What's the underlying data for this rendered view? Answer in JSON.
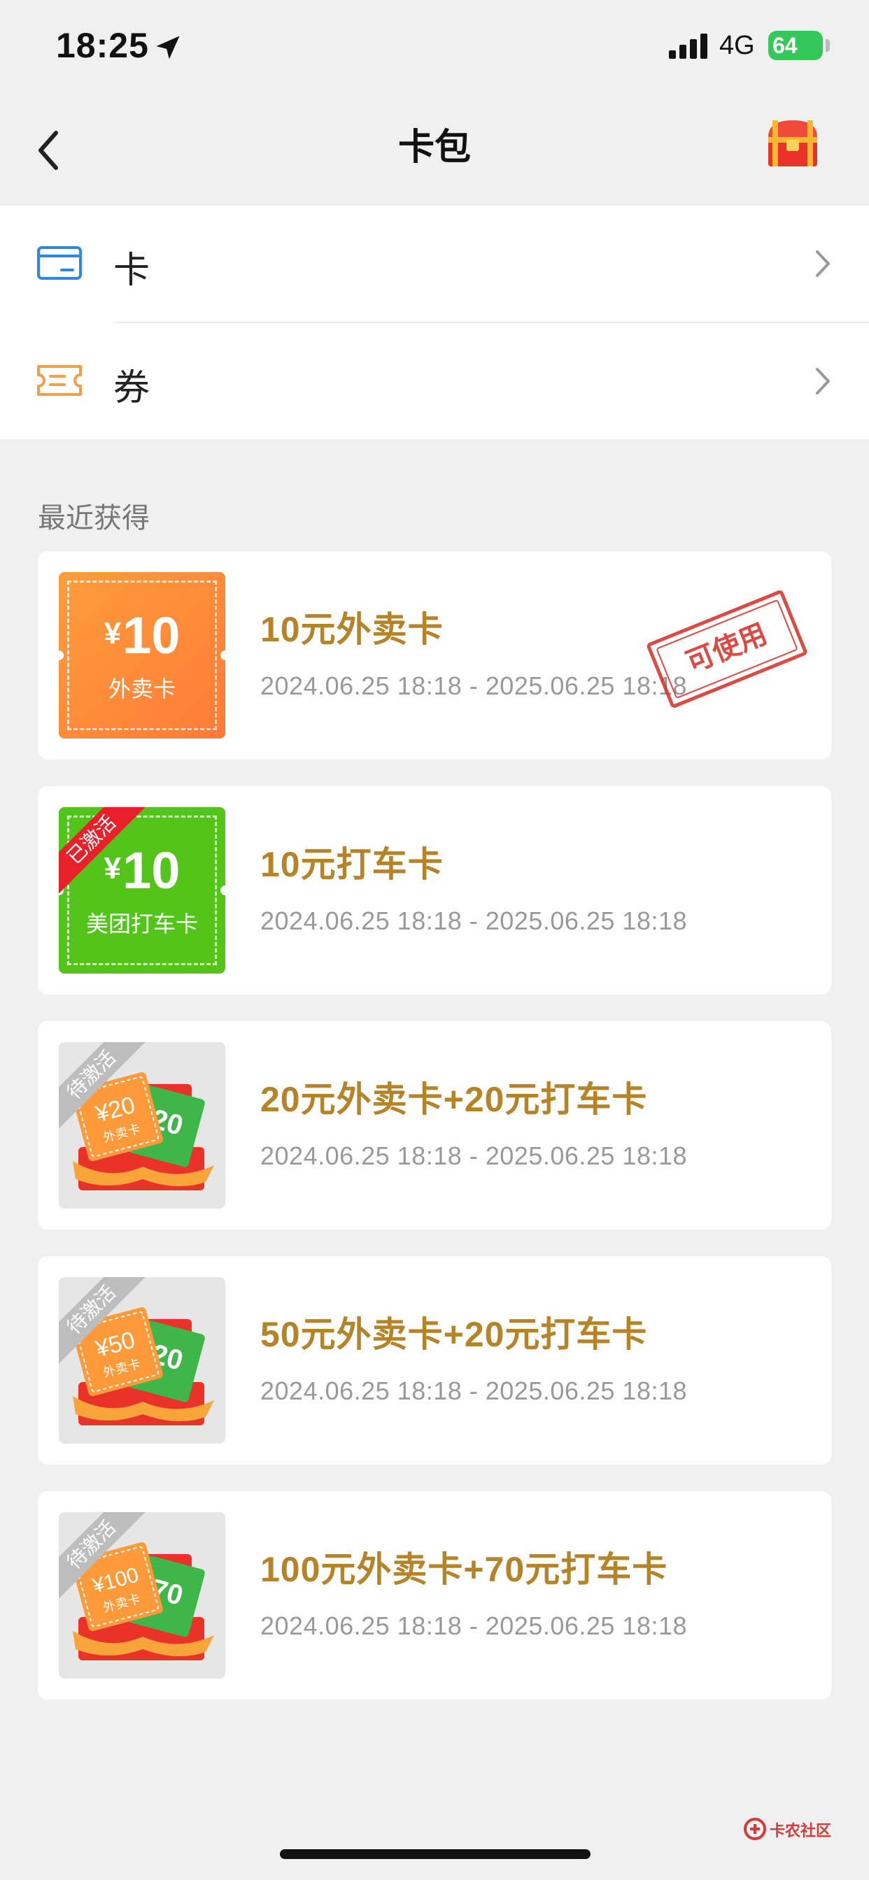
{
  "status_bar": {
    "time": "18:25",
    "network": "4G",
    "battery": "64"
  },
  "nav": {
    "title": "卡包"
  },
  "menu": [
    {
      "label": "卡",
      "icon": "card-icon"
    },
    {
      "label": "券",
      "icon": "ticket-icon"
    }
  ],
  "section_title": "最近获得",
  "cards": [
    {
      "title": "10元外卖卡",
      "date": "2024.06.25 18:18 - 2025.06.25 18:18",
      "thumb_amount": "10",
      "thumb_currency": "¥",
      "thumb_label": "外卖卡",
      "stamp": "可使用"
    },
    {
      "title": "10元打车卡",
      "date": "2024.06.25 18:18 - 2025.06.25 18:18",
      "thumb_amount": "10",
      "thumb_currency": "¥",
      "thumb_label": "美团打车卡",
      "ribbon": "已激活"
    },
    {
      "title": "20元外卖卡+20元打车卡",
      "date": "2024.06.25 18:18 - 2025.06.25 18:18",
      "ribbon": "待激活",
      "gift_front": "¥20",
      "gift_front_label": "外卖卡",
      "gift_back": "20"
    },
    {
      "title": "50元外卖卡+20元打车卡",
      "date": "2024.06.25 18:18 - 2025.06.25 18:18",
      "ribbon": "待激活",
      "gift_front": "¥50",
      "gift_front_label": "外卖卡",
      "gift_back": "20"
    },
    {
      "title": "100元外卖卡+70元打车卡",
      "date": "2024.06.25 18:18 - 2025.06.25 18:18",
      "ribbon": "待激活",
      "gift_front": "¥100",
      "gift_front_label": "外卖卡",
      "gift_back": "70"
    }
  ],
  "watermark": "卡农社区",
  "colors": {
    "accent_gold": "#b58328",
    "orange": "#ff8a3a",
    "green": "#52c41a",
    "stamp_red": "#d8372f"
  }
}
